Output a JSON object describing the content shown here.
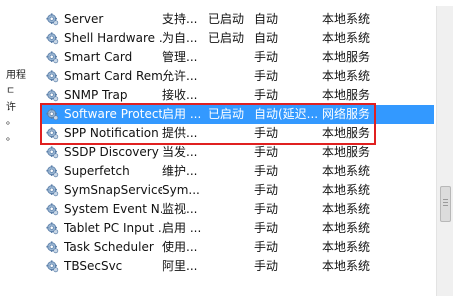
{
  "gutter": {
    "line1": "用程",
    "line2": "ㄷ",
    "line3": "许",
    "line4": "。",
    "line5": "。"
  },
  "services": [
    {
      "name": "Server",
      "desc": "支持...",
      "status": "已启动",
      "startup": "自动",
      "logon": "本地系统"
    },
    {
      "name": "Shell Hardware ...",
      "desc": "为自...",
      "status": "已启动",
      "startup": "自动",
      "logon": "本地系统"
    },
    {
      "name": "Smart Card",
      "desc": "管理...",
      "status": "",
      "startup": "手动",
      "logon": "本地服务"
    },
    {
      "name": "Smart Card Rem...",
      "desc": "允许...",
      "status": "",
      "startup": "手动",
      "logon": "本地系统"
    },
    {
      "name": "SNMP Trap",
      "desc": "接收...",
      "status": "",
      "startup": "手动",
      "logon": "本地服务"
    },
    {
      "name": "Software Protect...",
      "desc": "启用 ...",
      "status": "已启动",
      "startup": "自动(延迟...",
      "logon": "网络服务"
    },
    {
      "name": "SPP Notification ...",
      "desc": "提供...",
      "status": "",
      "startup": "手动",
      "logon": "本地服务"
    },
    {
      "name": "SSDP Discovery",
      "desc": "当发...",
      "status": "",
      "startup": "手动",
      "logon": "本地服务"
    },
    {
      "name": "Superfetch",
      "desc": "维护...",
      "status": "",
      "startup": "手动",
      "logon": "本地系统"
    },
    {
      "name": "SymSnapService",
      "desc": "Sym...",
      "status": "",
      "startup": "手动",
      "logon": "本地系统"
    },
    {
      "name": "System Event N...",
      "desc": "监视...",
      "status": "",
      "startup": "手动",
      "logon": "本地系统"
    },
    {
      "name": "Tablet PC Input ...",
      "desc": "启用 ...",
      "status": "",
      "startup": "手动",
      "logon": "本地系统"
    },
    {
      "name": "Task Scheduler",
      "desc": "使用...",
      "status": "",
      "startup": "手动",
      "logon": "本地系统"
    },
    {
      "name": "TBSecSvc",
      "desc": "阿里...",
      "status": "",
      "startup": "手动",
      "logon": "本地系统"
    }
  ],
  "selected_index": 5,
  "icon": "service-gear-icon",
  "colors": {
    "selection": "#3399ff",
    "highlight_border": "#e02020"
  }
}
